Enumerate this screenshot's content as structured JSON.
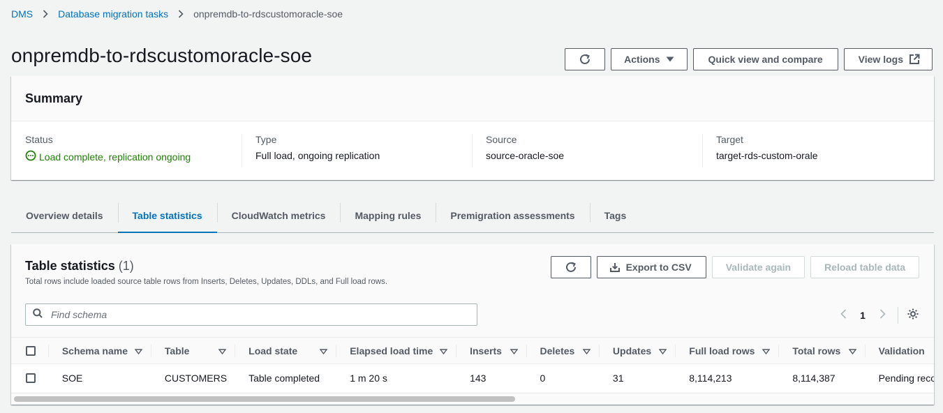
{
  "breadcrumb": [
    {
      "label": "DMS"
    },
    {
      "label": "Database migration tasks"
    },
    {
      "label": "onpremdb-to-rdscustomoracle-soe"
    }
  ],
  "page": {
    "title": "onpremdb-to-rdscustomoracle-soe",
    "actions_label": "Actions",
    "quick_view_label": "Quick view and compare",
    "view_logs_label": "View logs"
  },
  "summary": {
    "title": "Summary",
    "status_label": "Status",
    "status_value": "Load complete, replication ongoing",
    "type_label": "Type",
    "type_value": "Full load, ongoing replication",
    "source_label": "Source",
    "source_value": "source-oracle-soe",
    "target_label": "Target",
    "target_value": "target-rds-custom-orale"
  },
  "tabs": [
    {
      "label": "Overview details",
      "active": false
    },
    {
      "label": "Table statistics",
      "active": true
    },
    {
      "label": "CloudWatch metrics",
      "active": false
    },
    {
      "label": "Mapping rules",
      "active": false
    },
    {
      "label": "Premigration assessments",
      "active": false
    },
    {
      "label": "Tags",
      "active": false
    }
  ],
  "table_panel": {
    "title": "Table statistics",
    "count": "(1)",
    "description": "Total rows include loaded source table rows from Inserts, Deletes, Updates, DDLs, and Full load rows.",
    "export_label": "Export to CSV",
    "validate_label": "Validate again",
    "reload_label": "Reload table data",
    "search_placeholder": "Find schema",
    "current_page": "1"
  },
  "columns": [
    "Schema name",
    "Table",
    "Load state",
    "Elapsed load time",
    "Inserts",
    "Deletes",
    "Updates",
    "Full load rows",
    "Total rows",
    "Validation"
  ],
  "rows": [
    [
      "SOE",
      "CUSTOMERS",
      "Table completed",
      "1 m 20 s",
      "143",
      "0",
      "31",
      "8,114,213",
      "8,114,387",
      "Pending records"
    ]
  ],
  "colors": {
    "link": "#0073bb",
    "success": "#1d8102",
    "text": "#16191f",
    "muted": "#545b64"
  }
}
